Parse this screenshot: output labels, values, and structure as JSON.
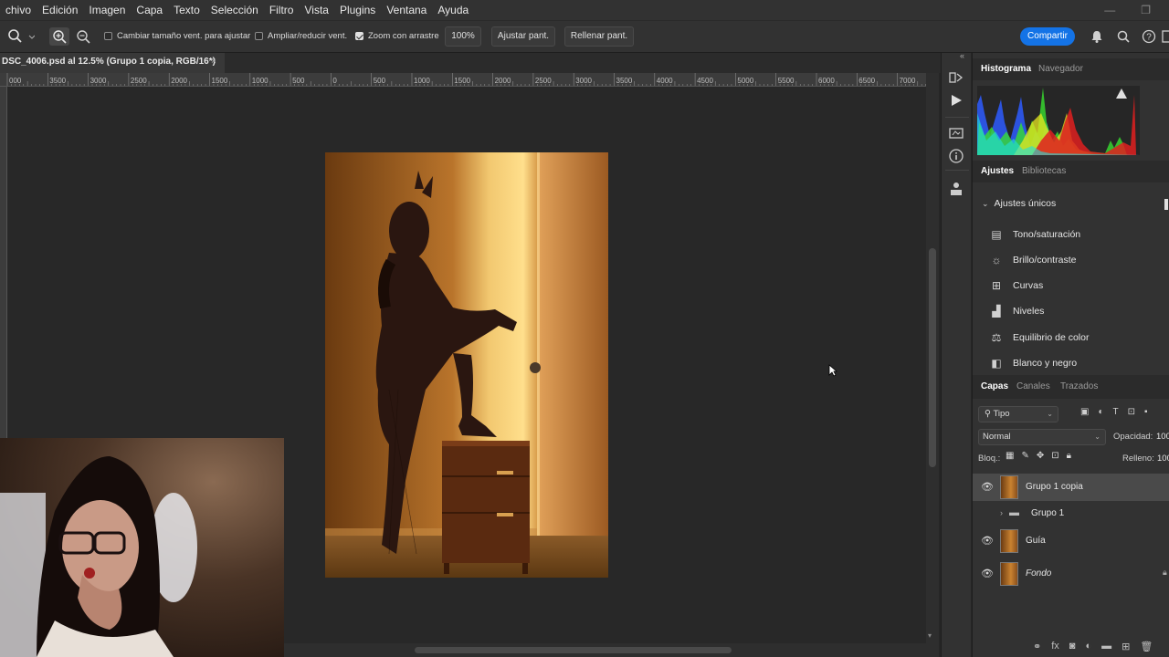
{
  "menu": [
    "chivo",
    "Edición",
    "Imagen",
    "Capa",
    "Texto",
    "Selección",
    "Filtro",
    "Vista",
    "Plugins",
    "Ventana",
    "Ayuda"
  ],
  "options": {
    "resize_windows": "Cambiar tamaño vent. para ajustar",
    "zoom_all": "Ampliar/reducir vent.",
    "scrubby_zoom": "Zoom con arrastre",
    "zoom_value": "100%",
    "fit_screen": "Ajustar pant.",
    "fill_screen": "Rellenar pant.",
    "share": "Compartir"
  },
  "document": {
    "tab_title": "DSC_4006.psd al 12.5% (Grupo 1 copia, RGB/16*)"
  },
  "ruler_labels": [
    "000",
    "3500",
    "3000",
    "2500",
    "2000",
    "1500",
    "1000",
    "500",
    "0",
    "500",
    "1000",
    "1500",
    "2000",
    "2500",
    "3000",
    "3500",
    "4000",
    "4500",
    "5000",
    "5500",
    "6000",
    "6500",
    "7000"
  ],
  "panels": {
    "histogram_tabs": [
      "Histograma",
      "Navegador"
    ],
    "adjust_tabs": [
      "Ajustes",
      "Bibliotecas"
    ],
    "adjust_section": "Ajustes únicos",
    "adjustments": [
      {
        "label": "Tono/saturación",
        "icon": "hue-saturation-icon"
      },
      {
        "label": "Brillo/contraste",
        "icon": "brightness-icon"
      },
      {
        "label": "Curvas",
        "icon": "curves-icon"
      },
      {
        "label": "Niveles",
        "icon": "levels-icon"
      },
      {
        "label": "Equilibrio de color",
        "icon": "color-balance-icon"
      },
      {
        "label": "Blanco y negro",
        "icon": "black-white-icon"
      }
    ],
    "layer_tabs": [
      "Capas",
      "Canales",
      "Trazados"
    ],
    "filter_kind": "Tipo",
    "blend_mode": "Normal",
    "opacity_label": "Opacidad:",
    "opacity_value": "100",
    "lock_label": "Bloq.:",
    "fill_label": "Relleno:",
    "fill_value": "100",
    "layers": [
      {
        "name": "Grupo 1 copia",
        "visible": true,
        "selected": true,
        "type": "pixel"
      },
      {
        "name": "Grupo 1",
        "visible": false,
        "selected": false,
        "type": "group"
      },
      {
        "name": "Guía",
        "visible": true,
        "selected": false,
        "type": "pixel"
      },
      {
        "name": "Fondo",
        "visible": true,
        "selected": false,
        "type": "background"
      }
    ]
  },
  "colors": {
    "share_button": "#1473e6",
    "app_bg": "#323232",
    "canvas_bg": "#282828"
  }
}
